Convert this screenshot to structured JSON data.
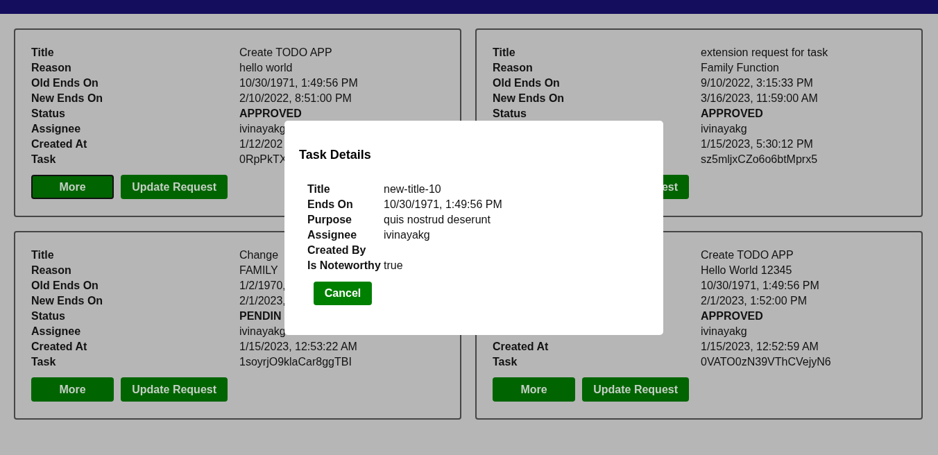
{
  "cards": [
    {
      "rows": [
        {
          "kind": "text",
          "label": "Title",
          "value": "Create TODO APP"
        },
        {
          "kind": "text",
          "label": "Reason",
          "value": "hello world"
        },
        {
          "kind": "text",
          "label": "Old Ends On",
          "value": "10/30/1971, 1:49:56 PM"
        },
        {
          "kind": "text",
          "label": "New Ends On",
          "value": "2/10/2022, 8:51:00 PM"
        },
        {
          "kind": "status",
          "label": "Status",
          "value": "APPROVED"
        },
        {
          "kind": "text",
          "label": "Assignee",
          "value": "ivinayakg"
        },
        {
          "kind": "text",
          "label": "Created At",
          "value": "1/12/202"
        },
        {
          "kind": "text",
          "label": "Task",
          "value": "0RpPkTX"
        }
      ],
      "buttons": [
        {
          "kind": "more",
          "label": "More",
          "focused": true
        },
        {
          "kind": "update",
          "label": "Update Request",
          "focused": false
        }
      ]
    },
    {
      "rows": [
        {
          "kind": "text",
          "label": "Title",
          "value": "extension request for task"
        },
        {
          "kind": "text",
          "label": "Reason",
          "value": "Family Function"
        },
        {
          "kind": "text",
          "label": "Old Ends On",
          "value": "9/10/2022, 3:15:33 PM"
        },
        {
          "kind": "text",
          "label": "New Ends On",
          "value": "3/16/2023, 11:59:00 AM"
        },
        {
          "kind": "status",
          "label": "Status",
          "value": "APPROVED"
        },
        {
          "kind": "text",
          "value": "ivinayakg"
        },
        {
          "kind": "text",
          "value": "1/15/2023, 5:30:12 PM"
        },
        {
          "kind": "text",
          "value": "sz5mljxCZo6o6btMprx5"
        }
      ],
      "buttons": [
        {
          "kind": "update",
          "label": "est",
          "focused": false
        }
      ]
    },
    {
      "rows": [
        {
          "kind": "text",
          "label": "Title",
          "value": "Change"
        },
        {
          "kind": "text",
          "label": "Reason",
          "value": "FAMILY"
        },
        {
          "kind": "text",
          "label": "Old Ends On",
          "value": "1/2/1970,"
        },
        {
          "kind": "text",
          "label": "New Ends On",
          "value": "2/1/2023,"
        },
        {
          "kind": "status",
          "label": "Status",
          "value": "PENDIN"
        },
        {
          "kind": "text",
          "label": "Assignee",
          "value": "ivinayakg"
        },
        {
          "kind": "text",
          "label": "Created At",
          "value": "1/15/2023, 12:53:22 AM"
        },
        {
          "kind": "text",
          "label": "Task",
          "value": "1soyrjO9klaCar8ggTBI"
        }
      ],
      "buttons": [
        {
          "kind": "more",
          "label": "More",
          "focused": false
        },
        {
          "kind": "update",
          "label": "Update Request",
          "focused": false
        }
      ]
    },
    {
      "rows": [
        {
          "kind": "text",
          "value": "Create TODO APP"
        },
        {
          "kind": "text",
          "value": "Hello World 12345"
        },
        {
          "kind": "text",
          "value": "10/30/1971, 1:49:56 PM"
        },
        {
          "kind": "text",
          "value": "2/1/2023, 1:52:00 PM"
        },
        {
          "kind": "status",
          "value": "APPROVED"
        },
        {
          "kind": "text",
          "value": "ivinayakg"
        },
        {
          "kind": "text",
          "label": "Created At",
          "value": "1/15/2023, 12:52:59 AM"
        },
        {
          "kind": "text",
          "label": "Task",
          "value": "0VATO0zN39VThCVejyN6"
        }
      ],
      "buttons": [
        {
          "kind": "more",
          "label": "More",
          "focused": false
        },
        {
          "kind": "update",
          "label": "Update Request",
          "focused": false
        }
      ]
    }
  ],
  "modal": {
    "title": "Task Details",
    "rows": [
      {
        "label": "Title",
        "value": "new-title-10"
      },
      {
        "label": "Ends On",
        "value": "10/30/1971, 1:49:56 PM"
      },
      {
        "label": "Purpose",
        "value": "quis nostrud deserunt"
      },
      {
        "label": "Assignee",
        "value": "ivinayakg"
      },
      {
        "label": "Created By"
      },
      {
        "label": "Is Noteworthy",
        "value": "true"
      }
    ],
    "button": "Cancel"
  }
}
